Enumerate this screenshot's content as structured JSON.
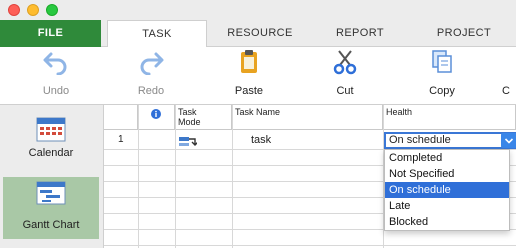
{
  "window": {
    "controls": [
      "close",
      "minimize",
      "maximize"
    ]
  },
  "tabs": [
    {
      "label": "FILE"
    },
    {
      "label": "TASK"
    },
    {
      "label": "RESOURCE"
    },
    {
      "label": "REPORT"
    },
    {
      "label": "PROJECT"
    }
  ],
  "toolbar": {
    "undo": {
      "label": "Undo",
      "icon": "undo-icon"
    },
    "redo": {
      "label": "Redo",
      "icon": "redo-icon"
    },
    "paste": {
      "label": "Paste",
      "icon": "paste-icon"
    },
    "cut": {
      "label": "Cut",
      "icon": "scissors-icon"
    },
    "copy": {
      "label": "Copy",
      "icon": "copy-icon"
    },
    "more": {
      "label": "C"
    }
  },
  "sidebar": {
    "items": [
      {
        "label": "Calendar",
        "icon": "calendar-icon"
      },
      {
        "label": "Gantt Chart",
        "icon": "gantt-chart-icon"
      }
    ]
  },
  "grid": {
    "columns": {
      "info": "info-icon",
      "mode_line1": "Task",
      "mode_line2": "Mode",
      "name": "Task Name",
      "health": "Health"
    },
    "rows": [
      {
        "id": "1",
        "name": "task",
        "health": "On schedule"
      }
    ]
  },
  "health_dropdown": {
    "current": "On schedule",
    "options": [
      "Completed",
      "Not Specified",
      "On schedule",
      "Late",
      "Blocked"
    ],
    "selected": "On schedule"
  },
  "colors": {
    "file_tab": "#2f8a3a",
    "selected": "#2f6fd8",
    "sidebar_active": "#a9c8a6"
  }
}
